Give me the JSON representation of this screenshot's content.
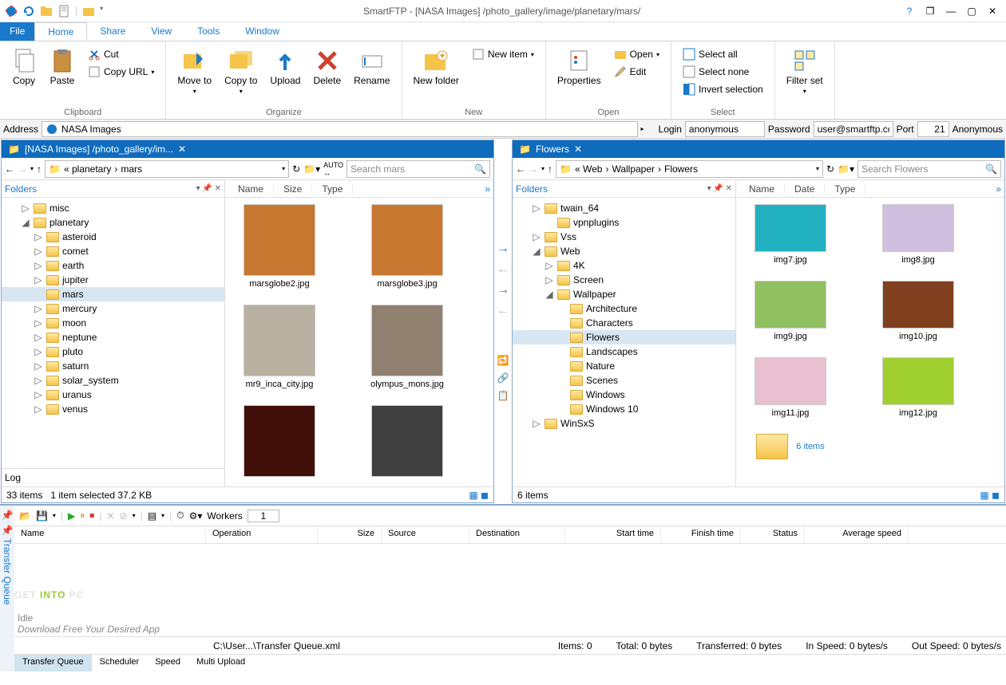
{
  "window": {
    "title": "SmartFTP - [NASA Images] /photo_gallery/image/planetary/mars/",
    "help": "?",
    "restore": "❐",
    "min": "—",
    "max": "▢",
    "close": "✕"
  },
  "menu": {
    "file": "File",
    "home": "Home",
    "share": "Share",
    "view": "View",
    "tools": "Tools",
    "window": "Window"
  },
  "ribbon": {
    "clipboard": {
      "copy": "Copy",
      "paste": "Paste",
      "cut": "Cut",
      "copyurl": "Copy URL",
      "label": "Clipboard"
    },
    "organize": {
      "moveto": "Move to",
      "copyto": "Copy to",
      "upload": "Upload",
      "delete": "Delete",
      "rename": "Rename",
      "label": "Organize"
    },
    "new": {
      "newfolder": "New folder",
      "newitem": "New item",
      "label": "New"
    },
    "open": {
      "properties": "Properties",
      "open": "Open",
      "edit": "Edit",
      "label": "Open"
    },
    "select": {
      "all": "Select all",
      "none": "Select none",
      "invert": "Invert selection",
      "label": "Select"
    },
    "filter": {
      "filterset": "Filter set",
      "label": ""
    }
  },
  "addr": {
    "label": "Address",
    "value": "NASA Images",
    "login": "Login",
    "loginval": "anonymous",
    "password": "Password",
    "passval": "user@smartftp.con",
    "port": "Port",
    "portval": "21",
    "anon": "Anonymous"
  },
  "panelLeft": {
    "tab": "[NASA Images] /photo_gallery/im...",
    "bread1": "« planetary",
    "bread2": "mars",
    "search": "Search mars",
    "foldersLabel": "Folders",
    "cols": {
      "name": "Name",
      "size": "Size",
      "type": "Type"
    },
    "tree": [
      {
        "pad": 24,
        "exp": "▷",
        "name": "misc"
      },
      {
        "pad": 24,
        "exp": "◢",
        "name": "planetary"
      },
      {
        "pad": 40,
        "exp": "▷",
        "name": "asteroid"
      },
      {
        "pad": 40,
        "exp": "▷",
        "name": "comet"
      },
      {
        "pad": 40,
        "exp": "▷",
        "name": "earth"
      },
      {
        "pad": 40,
        "exp": "▷",
        "name": "jupiter"
      },
      {
        "pad": 40,
        "exp": "",
        "name": "mars",
        "sel": true
      },
      {
        "pad": 40,
        "exp": "▷",
        "name": "mercury"
      },
      {
        "pad": 40,
        "exp": "▷",
        "name": "moon"
      },
      {
        "pad": 40,
        "exp": "▷",
        "name": "neptune"
      },
      {
        "pad": 40,
        "exp": "▷",
        "name": "pluto"
      },
      {
        "pad": 40,
        "exp": "▷",
        "name": "saturn"
      },
      {
        "pad": 40,
        "exp": "▷",
        "name": "solar_system"
      },
      {
        "pad": 40,
        "exp": "▷",
        "name": "uranus"
      },
      {
        "pad": 40,
        "exp": "▷",
        "name": "venus"
      }
    ],
    "thumbs": [
      "marsglobe2.jpg",
      "marsglobe3.jpg",
      "mr9_inca_city.jpg",
      "olympus_mons.jpg",
      "",
      ""
    ],
    "log": "Log",
    "status1": "33 items",
    "status2": "1 item selected  37.2 KB"
  },
  "panelRight": {
    "tab": "Flowers",
    "bread1": "« Web",
    "bread2": "Wallpaper",
    "bread3": "Flowers",
    "search": "Search Flowers",
    "foldersLabel": "Folders",
    "cols": {
      "name": "Name",
      "date": "Date",
      "type": "Type"
    },
    "tree": [
      {
        "pad": 24,
        "exp": "▷",
        "name": "twain_64"
      },
      {
        "pad": 40,
        "exp": "",
        "name": "vpnplugins"
      },
      {
        "pad": 24,
        "exp": "▷",
        "name": "Vss"
      },
      {
        "pad": 24,
        "exp": "◢",
        "name": "Web"
      },
      {
        "pad": 40,
        "exp": "▷",
        "name": "4K"
      },
      {
        "pad": 40,
        "exp": "▷",
        "name": "Screen"
      },
      {
        "pad": 40,
        "exp": "◢",
        "name": "Wallpaper"
      },
      {
        "pad": 56,
        "exp": "",
        "name": "Architecture"
      },
      {
        "pad": 56,
        "exp": "",
        "name": "Characters"
      },
      {
        "pad": 56,
        "exp": "",
        "name": "Flowers",
        "sel": true
      },
      {
        "pad": 56,
        "exp": "",
        "name": "Landscapes"
      },
      {
        "pad": 56,
        "exp": "",
        "name": "Nature"
      },
      {
        "pad": 56,
        "exp": "",
        "name": "Scenes"
      },
      {
        "pad": 56,
        "exp": "",
        "name": "Windows"
      },
      {
        "pad": 56,
        "exp": "",
        "name": "Windows 10"
      },
      {
        "pad": 24,
        "exp": "▷",
        "name": "WinSxS"
      }
    ],
    "thumbs": [
      "img7.jpg",
      "img8.jpg",
      "img9.jpg",
      "img10.jpg",
      "img11.jpg",
      "img12.jpg"
    ],
    "extra": "6 items",
    "status1": "6 items"
  },
  "queue": {
    "sideLabel": "Transfer Queue",
    "workers": "Workers",
    "workersval": "1",
    "cols": [
      "Name",
      "Operation",
      "Size",
      "Source",
      "Destination",
      "Start time",
      "Finish time",
      "Status",
      "Average speed"
    ],
    "watermark1": "GET ",
    "watermark2": "INTO",
    "watermark3": " PC",
    "idle": "Idle",
    "download": "Download Free Your Desired App",
    "path": "C:\\User...\\Transfer Queue.xml",
    "items": "Items: 0",
    "total": "Total: 0 bytes",
    "transferred": "Transferred: 0 bytes",
    "inspeed": "In Speed: 0 bytes/s",
    "outspeed": "Out Speed: 0 bytes/s",
    "tabs": [
      "Transfer Queue",
      "Scheduler",
      "Speed",
      "Multi Upload"
    ]
  },
  "thumbColors": {
    "mars": [
      "#c87830",
      "#c87830",
      "#b8b0a0",
      "#908070",
      "#401008",
      "#404040"
    ],
    "flowers": [
      "#20b0c0",
      "#d0c0e0",
      "#90c060",
      "#804020",
      "#e8c0d0",
      "#a0d030"
    ]
  }
}
